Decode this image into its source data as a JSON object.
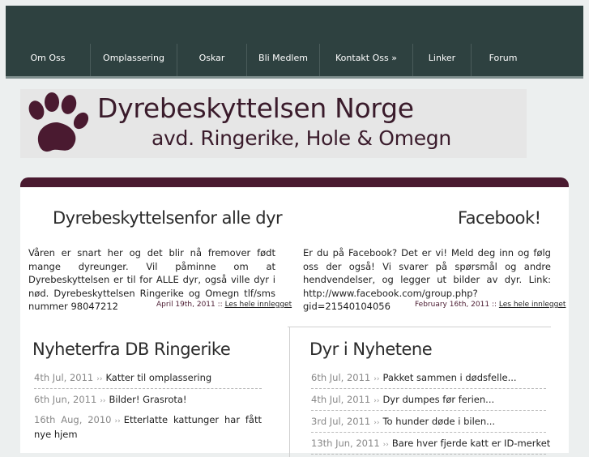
{
  "nav": {
    "items": [
      {
        "label": "Om Oss"
      },
      {
        "label": "Omplassering"
      },
      {
        "label": "Oskar"
      },
      {
        "label": "Bli Medlem"
      },
      {
        "label": "Kontakt Oss »"
      },
      {
        "label": "Linker"
      },
      {
        "label": "Forum"
      }
    ]
  },
  "banner": {
    "title": "Dyrebeskyttelsen Norge",
    "subtitle": "avd. Ringerike, Hole & Omegn"
  },
  "posts": {
    "left": {
      "heading": "Dyrebeskyttelsenfor alle dyr",
      "body": "Våren er snart her og det blir nå fremover født mange dyreunger. Vil påminne om at Dyrebeskyttelsen er til for ALLE dyr, også ville dyr i nød. Dyrebeskyttelsen Ringerike og Omegn tlf/sms nummer 98047212",
      "date": "April 19th, 2011",
      "sep": "::",
      "link": "Les hele innlegget"
    },
    "right": {
      "heading": "Facebook!",
      "body": "Er du på Facebook? Det er vi! Meld deg inn og følg oss der også! Vi svarer på spørsmål og andre hendvendelser, og legger ut bilder av dyr. Link: http://www.facebook.com/group.php?gid=21540104056",
      "date": "February 16th, 2011",
      "sep": "::",
      "link": "Les hele innlegget"
    }
  },
  "news_local": {
    "heading": "Nyheterfra DB Ringerike",
    "items": [
      {
        "date": "4th Jul, 2011",
        "title": "Katter til omplassering"
      },
      {
        "date": "6th Jun, 2011",
        "title": "Bilder! Grasrota!"
      },
      {
        "date": "16th Aug, 2010",
        "title": "Etterlatte kattunger har fått nye hjem"
      }
    ]
  },
  "news_animals": {
    "heading": "Dyr i Nyhetene",
    "items": [
      {
        "date": "6th Jul, 2011",
        "title": "Pakket sammen i dødsfelle..."
      },
      {
        "date": "4th Jul, 2011",
        "title": "Dyr dumpes før ferien..."
      },
      {
        "date": "3rd Jul, 2011",
        "title": "To hunder døde i bilen..."
      },
      {
        "date": "13th Jun, 2011",
        "title": "Bare hver fjerde katt er ID-merket"
      }
    ]
  },
  "separator_glyph": "››",
  "colors": {
    "nav_bg": "#2e4140",
    "accent": "#4a1a30",
    "banner_text": "#3a1b2b"
  }
}
